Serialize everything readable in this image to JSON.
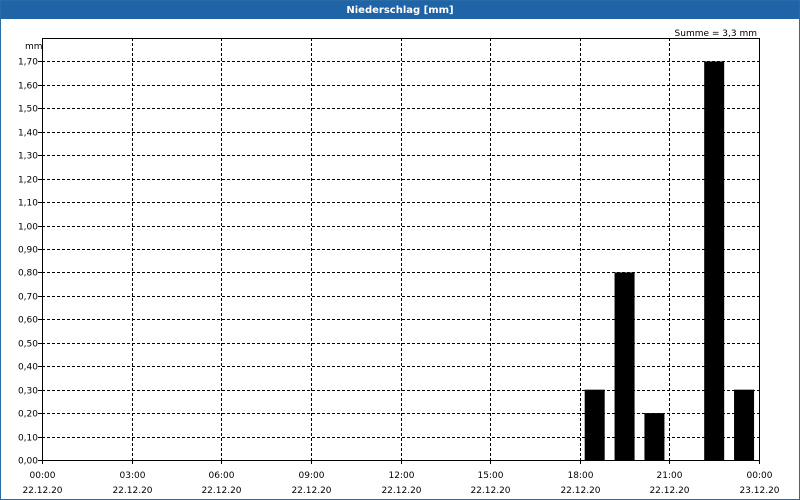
{
  "window": {
    "title": "Niederschlag [mm]"
  },
  "chart_data": {
    "type": "bar",
    "title": "Niederschlag [mm]",
    "ylabel": "mm",
    "summary": "Summe = 3,3 mm",
    "ylim": [
      0,
      1.8
    ],
    "yticks": [
      "0,00",
      "0,10",
      "0,20",
      "0,30",
      "0,40",
      "0,50",
      "0,60",
      "0,70",
      "0,80",
      "0,90",
      "1,00",
      "1,10",
      "1,20",
      "1,30",
      "1,40",
      "1,50",
      "1,60",
      "1,70"
    ],
    "xlim": [
      "22.12.20 00:00",
      "23.12.20 00:00"
    ],
    "xticks": [
      {
        "time": "00:00",
        "date": "22.12.20"
      },
      {
        "time": "03:00",
        "date": "22.12.20"
      },
      {
        "time": "06:00",
        "date": "22.12.20"
      },
      {
        "time": "09:00",
        "date": "22.12.20"
      },
      {
        "time": "12:00",
        "date": "22.12.20"
      },
      {
        "time": "15:00",
        "date": "22.12.20"
      },
      {
        "time": "18:00",
        "date": "22.12.20"
      },
      {
        "time": "21:00",
        "date": "22.12.20"
      },
      {
        "time": "00:00",
        "date": "23.12.20"
      }
    ],
    "bars": [
      {
        "x": "22.12.20 18:30",
        "value": 0.3
      },
      {
        "x": "22.12.20 19:30",
        "value": 0.8
      },
      {
        "x": "22.12.20 20:30",
        "value": 0.2
      },
      {
        "x": "22.12.20 22:30",
        "value": 1.7
      },
      {
        "x": "22.12.20 23:30",
        "value": 0.3
      }
    ],
    "grid": true,
    "bar_color": "#000000"
  }
}
